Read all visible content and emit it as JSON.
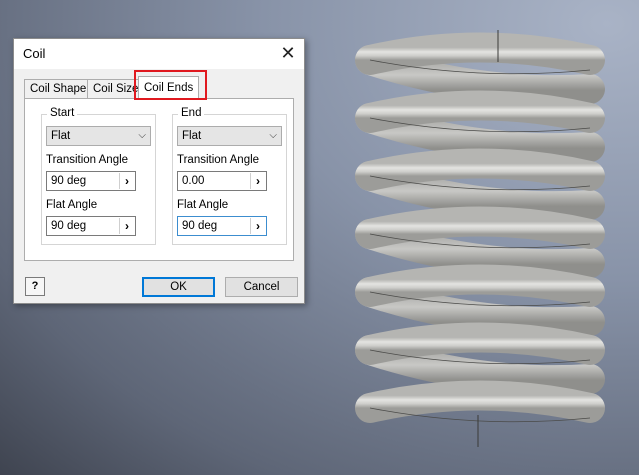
{
  "dialog": {
    "title": "Coil",
    "close_glyph": "✕",
    "tabs": [
      {
        "label": "Coil Shape",
        "active": false
      },
      {
        "label": "Coil Size",
        "active": false
      },
      {
        "label": "Coil Ends",
        "active": true
      }
    ],
    "start": {
      "group_label": "Start",
      "type_value": "Flat",
      "transition_angle_label": "Transition Angle",
      "transition_angle_value": "90 deg",
      "flat_angle_label": "Flat Angle",
      "flat_angle_value": "90 deg"
    },
    "end": {
      "group_label": "End",
      "type_value": "Flat",
      "transition_angle_label": "Transition Angle",
      "transition_angle_value": "0.00",
      "flat_angle_label": "Flat Angle",
      "flat_angle_value": "90 deg"
    },
    "help_glyph": "?",
    "ok_label": "OK",
    "cancel_label": "Cancel",
    "highlight_color": "#e0191f"
  },
  "icons": {
    "close": "close-icon",
    "chevron": "chevron-down-icon",
    "arrow": "chevron-right-icon",
    "help": "help-icon"
  }
}
